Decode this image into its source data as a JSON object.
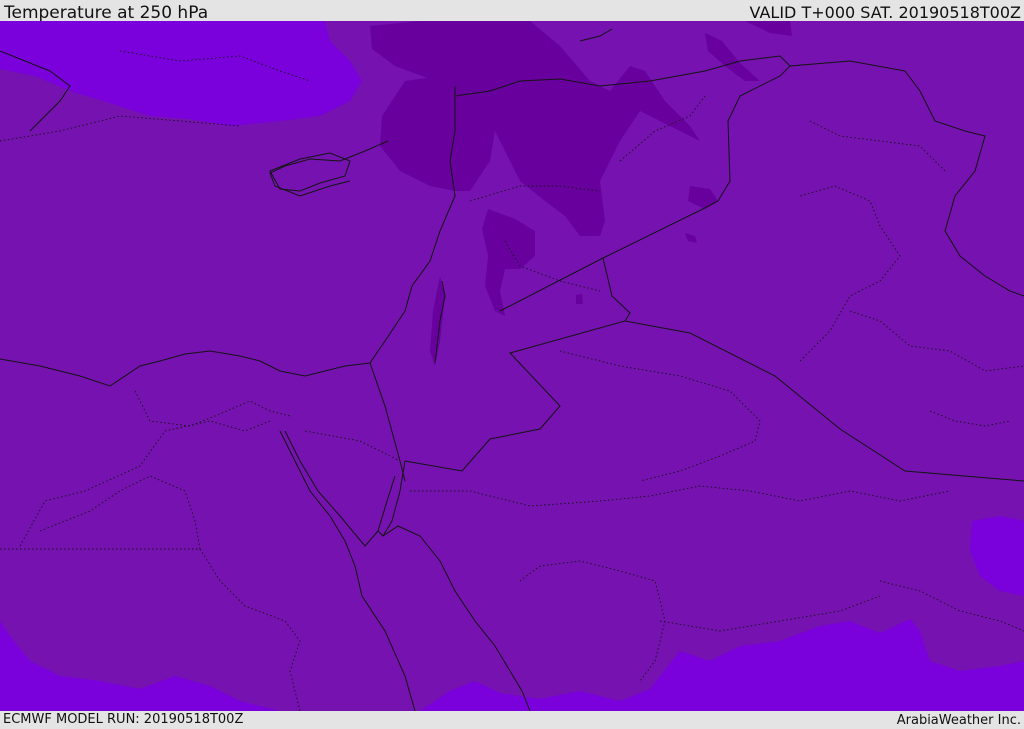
{
  "header": {
    "title": "Temperature at 250 hPa",
    "valid": "VALID T+000 SAT. 20190518T00Z"
  },
  "footer": {
    "model_run": "ECMWF MODEL RUN: 20190518T00Z",
    "credit": "ArabiaWeather Inc."
  },
  "colors": {
    "base_fill": "#7512b0",
    "warm_band": "#7a00dc",
    "cold_band": "#68009e",
    "border_line": "#141414",
    "header_bg": "#e4e4e4"
  }
}
